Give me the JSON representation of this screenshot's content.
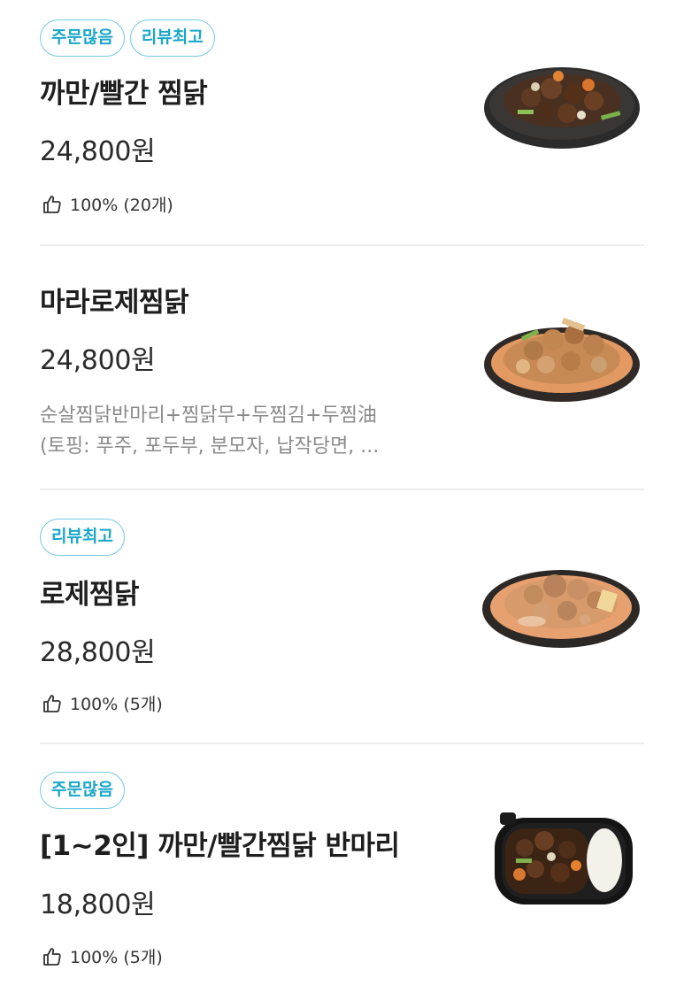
{
  "items": [
    {
      "badges": [
        "주문많음",
        "리뷰최고"
      ],
      "name": "까만/빨간 찜닭",
      "price": "24,800원",
      "likes": "100% (20개)",
      "image": "braised-chicken-black-dish"
    },
    {
      "badges": [],
      "name": "마라로제찜닭",
      "price": "24,800원",
      "desc_line1": "순살찜닭반마리+찜닭무+두찜김+두찜油",
      "desc_line2": "(토핑: 푸주, 포두부, 분모자, 납작당면, ...",
      "image": "mala-rose-chicken-dish"
    },
    {
      "badges": [
        "리뷰최고"
      ],
      "name": "로제찜닭",
      "price": "28,800원",
      "likes": "100% (5개)",
      "image": "rose-chicken-dish"
    },
    {
      "badges": [
        "주문많음"
      ],
      "name": "[1~2인] 까만/빨간찜닭 반마리",
      "price": "18,800원",
      "likes": "100% (5개)",
      "image": "half-chicken-rice-box"
    }
  ],
  "icons": {
    "like": "thumbs-up-icon"
  },
  "colors": {
    "badge_border": "#74c9df",
    "badge_text": "#1aa6c9",
    "desc_text": "#8a8a8a"
  }
}
